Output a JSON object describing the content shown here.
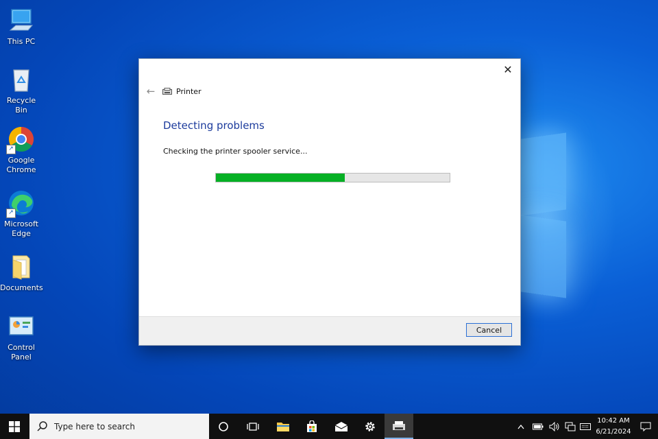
{
  "desktop": {
    "icons": [
      {
        "label": "This PC",
        "icon": "computer-icon"
      },
      {
        "label": "Recycle Bin",
        "icon": "recycle-bin-icon"
      },
      {
        "label_line1": "Google",
        "label_line2": "Chrome",
        "icon": "chrome-icon"
      },
      {
        "label_line1": "Microsoft",
        "label_line2": "Edge",
        "icon": "edge-icon"
      },
      {
        "label": "Documents",
        "icon": "folder-icon"
      },
      {
        "label": "Control Panel",
        "icon": "control-panel-icon"
      }
    ]
  },
  "dialog": {
    "close_glyph": "✕",
    "back_glyph": "←",
    "title": "Printer",
    "heading": "Detecting problems",
    "status": "Checking the printer spooler service...",
    "progress": 0.55,
    "cancel_label": "Cancel"
  },
  "taskbar": {
    "search_placeholder": "Type here to search",
    "time": "10:42 AM",
    "date": "6/21/2024",
    "colors": {
      "background": "#101010",
      "accent": "#7fb3ea"
    }
  },
  "colors": {
    "heading": "#1c3b9c",
    "progress_fill": "#06b025"
  }
}
